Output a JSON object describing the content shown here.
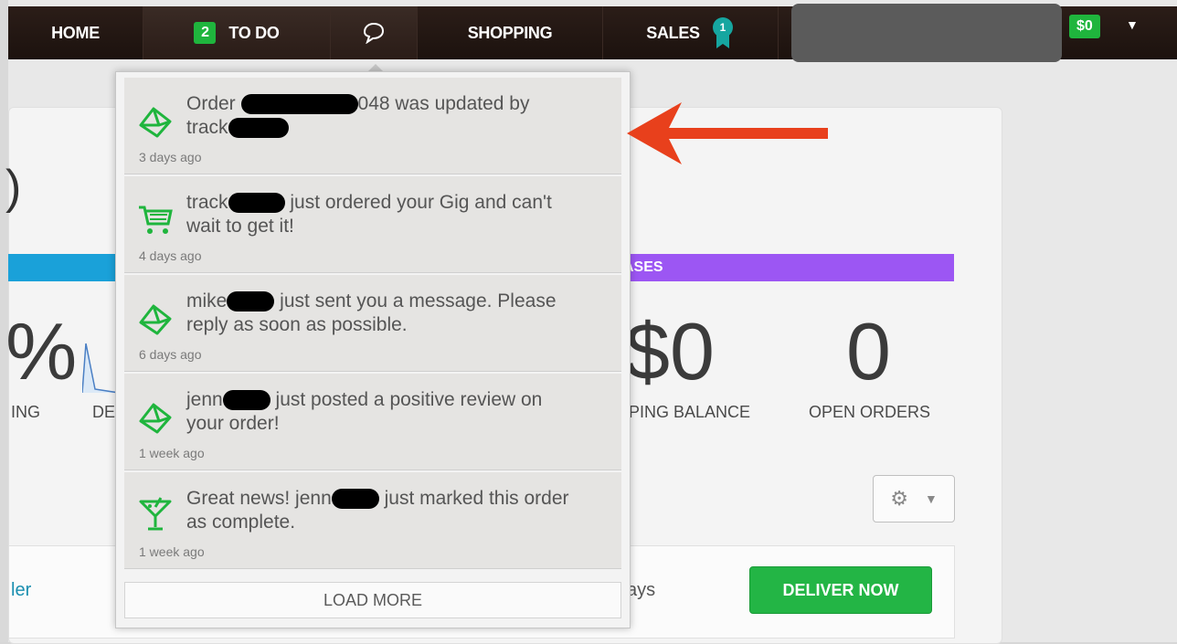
{
  "nav": {
    "home": "HOME",
    "todo_count": "2",
    "todo": "TO DO",
    "shopping": "SHOPPING",
    "sales": "SALES",
    "sales_badge": "1",
    "balance": "$0",
    "caret": "▼"
  },
  "dashboard": {
    "left_paren": ")",
    "left_percent": "%",
    "left_label": "ING",
    "left_label2": "DE",
    "purchases_header": "ASES",
    "shopping_balance_value": "$0",
    "shopping_balance_label": "PING BALANCE",
    "open_orders_value": "0",
    "open_orders_label": "OPEN ORDERS",
    "order_link": "ler",
    "order_days": "ays",
    "deliver_button": "DELIVER NOW"
  },
  "notifications": {
    "items": [
      {
        "icon": "envelope-icon",
        "prefix": "Order ",
        "middle": "048 was updated by",
        "line2": "track",
        "time": "3 days ago"
      },
      {
        "icon": "cart-icon",
        "prefix": "track",
        "middle": " just ordered your Gig and can't",
        "line2": "wait to get it!",
        "time": "4 days ago"
      },
      {
        "icon": "envelope-icon",
        "prefix": "mike",
        "middle": " just sent you a message. Please",
        "line2": "reply as soon as possible.",
        "time": "6 days ago"
      },
      {
        "icon": "envelope-icon",
        "prefix": "jenn",
        "middle": " just posted a positive review on",
        "line2": "your order!",
        "time": "1 week ago"
      },
      {
        "icon": "cocktail-icon",
        "prefix": "Great news! jenn",
        "middle": " just marked this order",
        "line2": "as complete.",
        "time": "1 week ago"
      }
    ],
    "load_more": "LOAD MORE"
  },
  "colors": {
    "accent_green": "#1fb53d",
    "arrow_red": "#e8401c",
    "purple_stripe": "#9c56f3",
    "blue_stripe": "#1aa1d9"
  }
}
